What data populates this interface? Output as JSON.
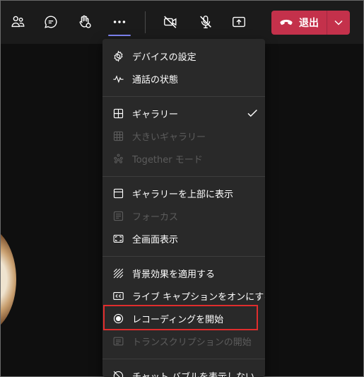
{
  "toolbar": {
    "buttons": [
      {
        "name": "participants",
        "icon": "people-icon"
      },
      {
        "name": "chat",
        "icon": "chat-bubble-icon"
      },
      {
        "name": "reactions",
        "icon": "raise-hand-icon"
      },
      {
        "name": "more-actions",
        "icon": "more-dots-icon"
      },
      {
        "name": "camera",
        "icon": "camera-off-icon"
      },
      {
        "name": "mic",
        "icon": "mic-off-icon"
      },
      {
        "name": "share",
        "icon": "share-tray-icon"
      }
    ],
    "leave_label": "退出",
    "leave_color": "#c4314b",
    "active_color": "#7f85f5"
  },
  "menu": {
    "items": [
      {
        "label": "デバイスの設定",
        "icon": "gear-icon",
        "enabled": true
      },
      {
        "label": "通話の状態",
        "icon": "pulse-icon",
        "enabled": true
      },
      {
        "label": "ギャラリー",
        "icon": "grid-icon",
        "enabled": true,
        "checked": true
      },
      {
        "label": "大きいギャラリー",
        "icon": "large-grid-icon",
        "enabled": false
      },
      {
        "label": "Together モード",
        "icon": "together-mode-icon",
        "enabled": false
      },
      {
        "label": "ギャラリーを上部に表示",
        "icon": "gallery-top-icon",
        "enabled": true
      },
      {
        "label": "フォーカス",
        "icon": "focus-icon",
        "enabled": false
      },
      {
        "label": "全画面表示",
        "icon": "fullscreen-icon",
        "enabled": true
      },
      {
        "label": "背景効果を適用する",
        "icon": "background-effects-icon",
        "enabled": true
      },
      {
        "label": "ライブ キャプションをオンにする",
        "icon": "closed-caption-icon",
        "enabled": true
      },
      {
        "label": "レコーディングを開始",
        "icon": "record-icon",
        "enabled": true
      },
      {
        "label": "トランスクリプションの開始",
        "icon": "transcript-icon",
        "enabled": false
      },
      {
        "label": "チャット バブルを表示しない",
        "icon": "chat-bubble-off-icon",
        "enabled": true
      }
    ]
  },
  "highlight_color": "#e02d2d"
}
